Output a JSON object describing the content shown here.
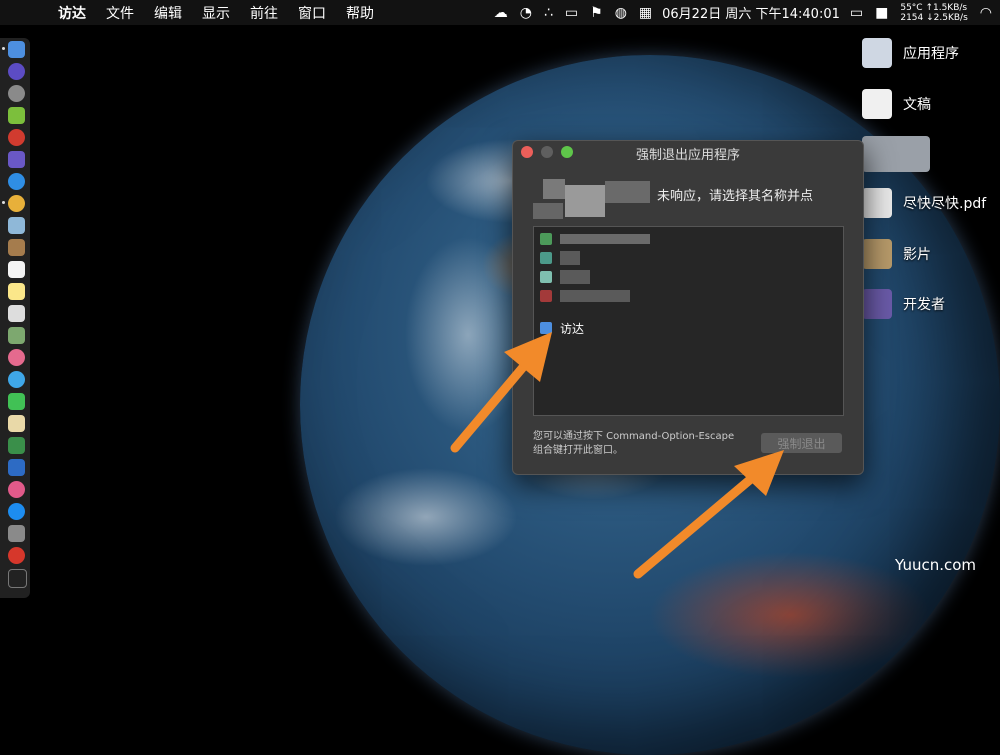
{
  "menubar": {
    "app_name": "访达",
    "items": [
      "文件",
      "编辑",
      "显示",
      "前往",
      "窗口",
      "帮助"
    ],
    "clock": "06月22日 周六 下午14:40:01",
    "stats_line1": "55°C ↑1.5KB/s",
    "stats_line2": "2154 ↓2.5KB/s"
  },
  "desktop": {
    "items": [
      "应用程序",
      "文稿",
      "尽快尽快.pdf",
      "影片",
      "开发者"
    ]
  },
  "dialog": {
    "title": "强制退出应用程序",
    "message": "未响应，请选择其名称并点",
    "selected_app": "访达",
    "hint_line1": "您可以通过按下 Command-Option-Escape",
    "hint_line2": "组合键打开此窗口。",
    "force_quit_label": "强制退出"
  },
  "watermark": "Yuucn.com",
  "colors": {
    "arrow": "#f28a2a",
    "close": "#ec5f5a",
    "minimize": "#5f5f5f",
    "zoom": "#5fc64a"
  }
}
